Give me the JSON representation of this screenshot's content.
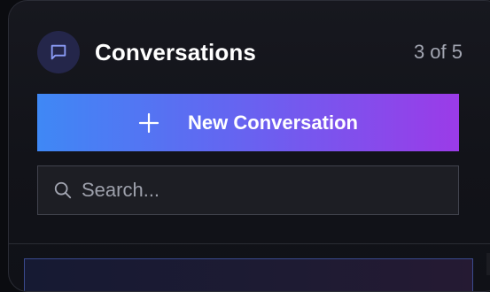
{
  "header": {
    "title": "Conversations",
    "count": "3 of 5",
    "icon": "chat-bubble-icon"
  },
  "new_conversation": {
    "label": "New Conversation",
    "icon": "plus-icon",
    "gradient_start": "#3f88f5",
    "gradient_end": "#9b3be8"
  },
  "search": {
    "placeholder": "Search...",
    "value": "",
    "icon": "search-icon"
  },
  "colors": {
    "panel_bg": "#15161c",
    "accent_icon_bg": "#24264a",
    "selected_item_border": "#3a4a8e"
  }
}
